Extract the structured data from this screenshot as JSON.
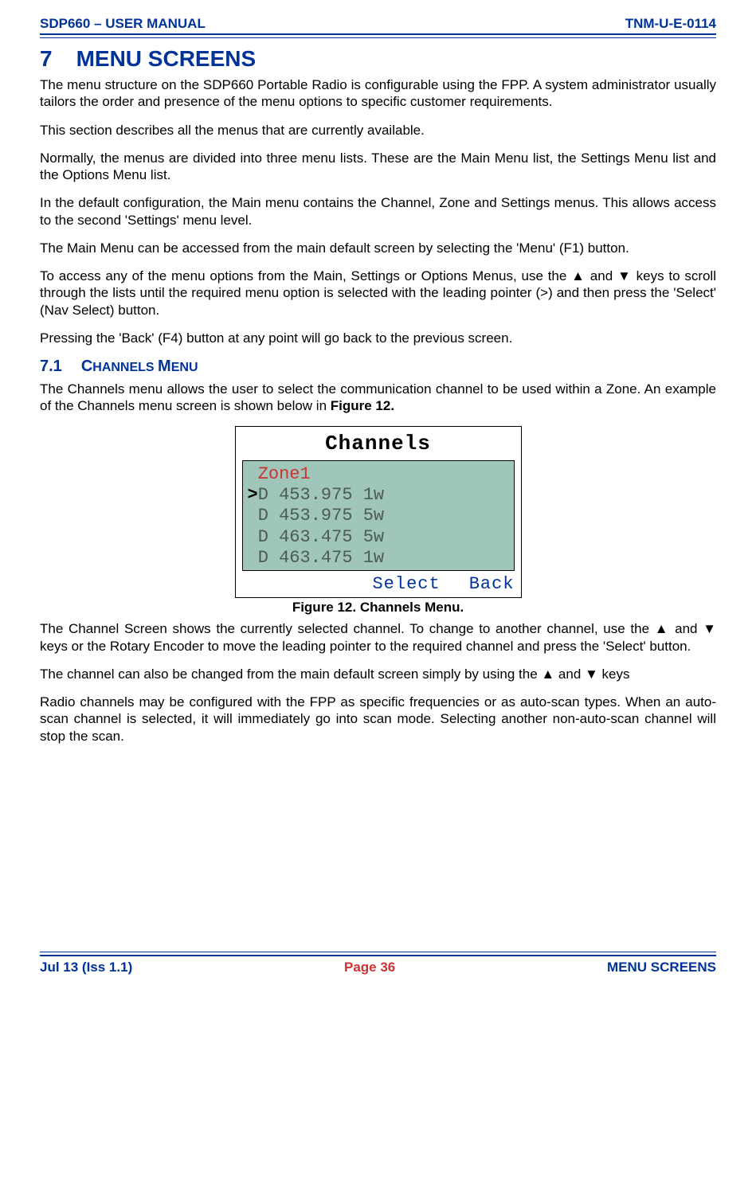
{
  "header": {
    "left": "SDP660 – USER MANUAL",
    "right": "TNM-U-E-0114"
  },
  "section": {
    "number": "7",
    "title": "MENU SCREENS"
  },
  "paragraphs": {
    "p1": "The menu structure on the SDP660 Portable Radio is configurable using the FPP.  A system administrator usually tailors the order and presence of the menu options to specific customer requirements.",
    "p2": "This section describes all the menus that are currently available.",
    "p3": "Normally, the menus are divided into three menu lists.  These are the Main Menu list, the Settings Menu list and the Options Menu list.",
    "p4": "In the default configuration, the Main menu contains the Channel, Zone and Settings menus.  This allows access to the second 'Settings' menu level.",
    "p5": "The Main Menu can be accessed from the main default screen by selecting the 'Menu' (F1) button.",
    "p6": "To access any of the menu options from the Main, Settings or Options Menus, use the ▲ and ▼ keys to scroll through the lists until the required menu option is selected with the leading pointer (>) and then press the 'Select' (Nav Select) button.",
    "p7": "Pressing the 'Back' (F4) button at any point will go back to the previous screen."
  },
  "subsection": {
    "number": "7.1",
    "title_caps": "C",
    "title_rest1": "HANNELS ",
    "title_caps2": "M",
    "title_rest2": "ENU",
    "p1": "The Channels menu allows the user to select the communication channel to be used within a Zone.  An example of the Channels menu screen is shown below in ",
    "p1_bold": "Figure 12."
  },
  "lcd": {
    "title": "Channels",
    "zone": " Zone1",
    "rows": {
      "r1_ptr": ">",
      "r1": "D 453.975 1w",
      "r2": " D 453.975 5w",
      "r3": " D 463.475 5w",
      "r4": " D 463.475 1w"
    },
    "softkeys": {
      "select": "Select",
      "back": "Back"
    }
  },
  "caption": "Figure 12.  Channels Menu.",
  "after": {
    "p1": "The Channel Screen shows the currently selected channel.  To change to another channel, use the ▲ and ▼ keys or the Rotary Encoder to move the leading pointer to the required channel and press the 'Select' button.",
    "p2": "The channel can also be changed from the main default screen simply by using the ▲ and ▼ keys",
    "p3": "Radio channels may be configured with the FPP as specific frequencies or as auto-scan types.  When an auto-scan channel is selected, it will immediately go into scan mode.  Selecting another non-auto-scan channel will stop the scan."
  },
  "footer": {
    "left": "Jul 13 (Iss 1.1)",
    "mid": "Page 36",
    "right": "MENU SCREENS"
  }
}
